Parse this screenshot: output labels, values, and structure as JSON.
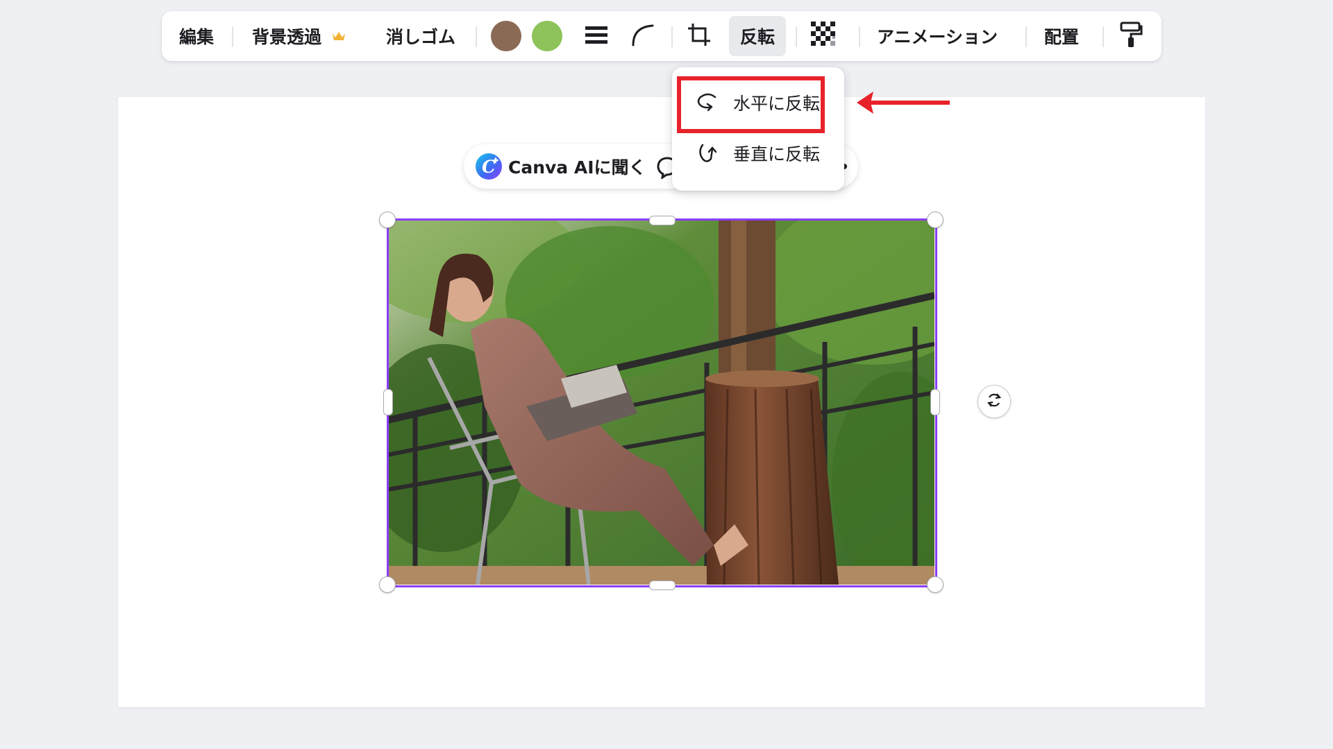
{
  "toolbar": {
    "edit_label": "編集",
    "bg_remove_label": "背景透過",
    "eraser_label": "消しゴム",
    "flip_label": "反転",
    "animation_label": "アニメーション",
    "arrange_label": "配置",
    "colors": [
      "#8a6a55",
      "#8ec25a"
    ],
    "icons": [
      "crown-icon",
      "lines-icon",
      "corner-rounding-icon",
      "crop-icon",
      "transparency-icon",
      "paint-roller-icon"
    ]
  },
  "ai_bar": {
    "label": "Canva AIに聞く"
  },
  "flip_menu": {
    "items": [
      {
        "label": "水平に反転",
        "icon": "flip-horizontal-icon"
      },
      {
        "label": "垂直に反転",
        "icon": "flip-vertical-icon"
      }
    ]
  },
  "annotation": {
    "highlight_color": "#e8222a"
  },
  "selection": {
    "accent": "#8b3dff"
  }
}
